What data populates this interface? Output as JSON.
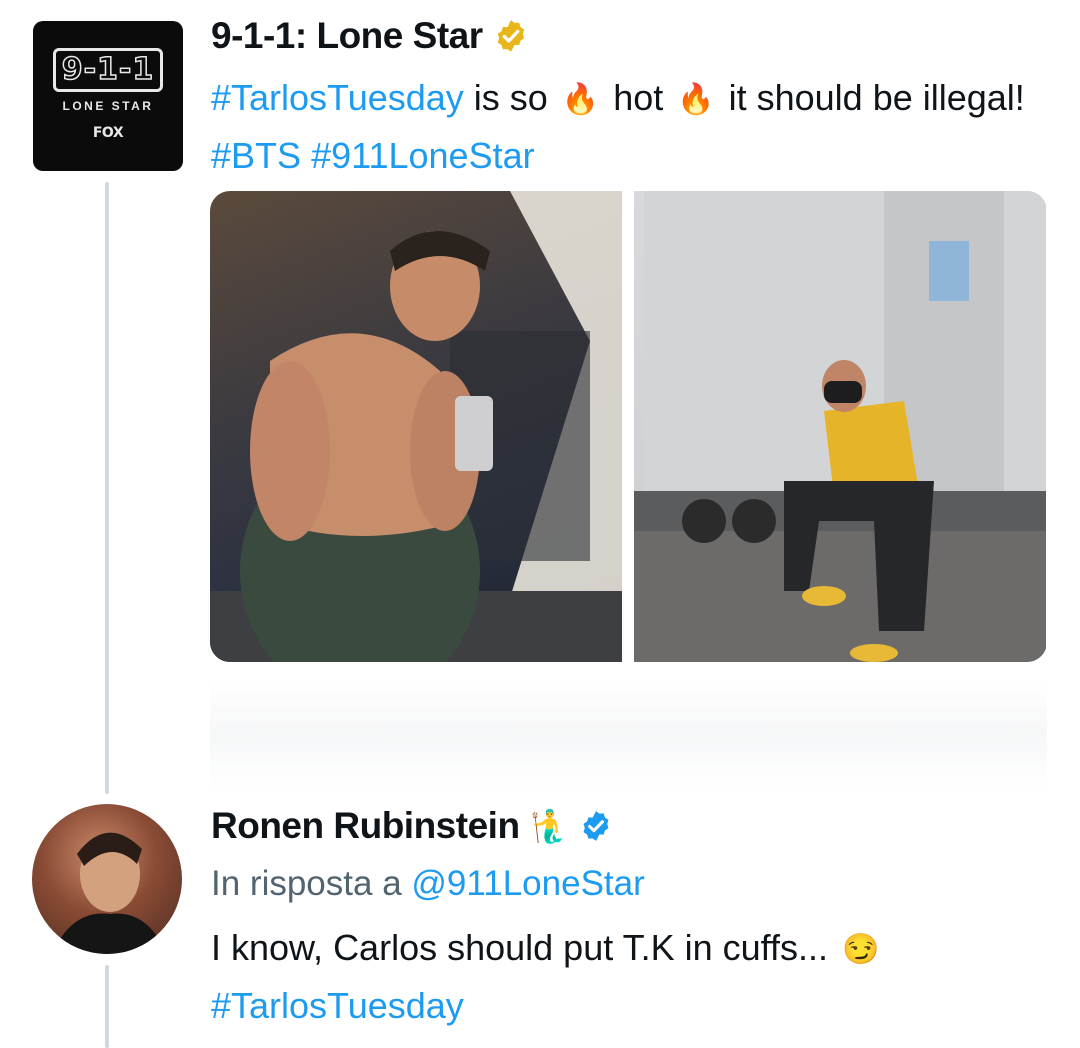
{
  "tweet": {
    "author": "9-1-1: Lone Star",
    "avatar_logo": {
      "main": "9-1-1",
      "sub": "LONE STAR",
      "network": "FOX"
    },
    "text_parts": [
      "#TarlosTuesday",
      " is so ",
      "🔥",
      " hot ",
      "🔥",
      " it should be illegal! ",
      "#BTS",
      " ",
      "#911LoneStar"
    ],
    "verified_badge": "gold",
    "media_count": 2
  },
  "reply": {
    "author": "Ronen Rubinstein",
    "author_emoji": "🧜‍♂️",
    "verified_badge": "blue",
    "reply_to_label": "In risposta a ",
    "reply_to_handle": "@911LoneStar",
    "text": "I know, Carlos should put T.K in cuffs... ",
    "text_emoji": "😏",
    "hashtag": "#TarlosTuesday"
  },
  "colors": {
    "link": "#1d9bf0",
    "muted": "#536471",
    "thread_line": "#cfd9de",
    "gold_badge": "#e8b51a",
    "blue_badge": "#1d9bf0"
  }
}
